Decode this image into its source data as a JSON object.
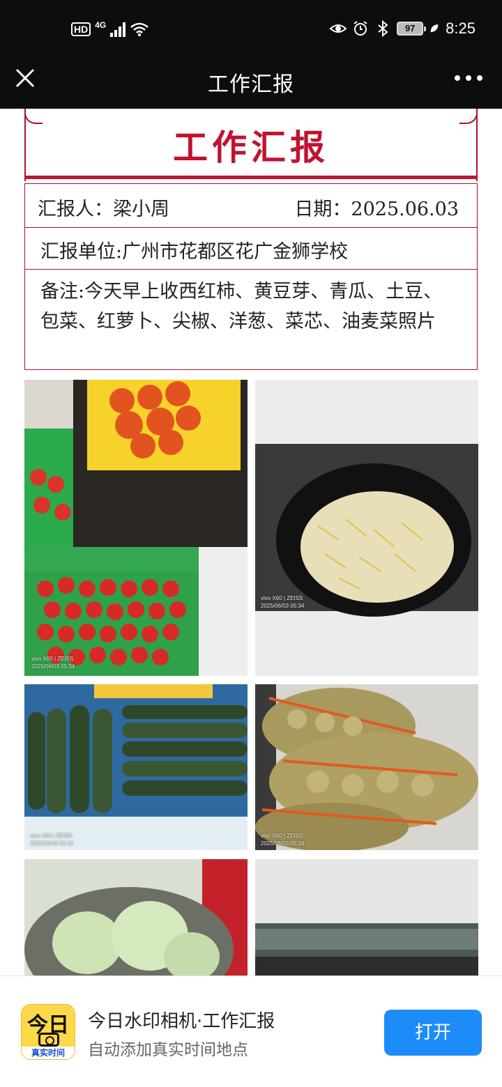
{
  "status_bar": {
    "hd_label": "HD",
    "network_label": "4G",
    "battery_level": "97",
    "time": "8:25",
    "icons": [
      "hd-icon",
      "signal-icon",
      "wifi-icon",
      "eye-icon",
      "alarm-icon",
      "bluetooth-icon",
      "battery-icon",
      "leaf-icon"
    ]
  },
  "nav": {
    "title": "工作汇报",
    "close_icon": "close-icon",
    "more_icon": "more-icon"
  },
  "report": {
    "title": "工作汇报",
    "reporter": "汇报人：梁小周",
    "date": "日期：2025.06.03",
    "unit": "汇报单位:广州市花都区花广金狮学校",
    "note": "备注:今天早上收西红柿、黄豆芽、青瓜、土豆、包菜、红萝卜、尖椒、洋葱、菜芯、油麦菜照片",
    "accent_color": "#c0132f"
  },
  "photos": [
    {
      "watermark_device": "vivo X60 | ZEISS",
      "watermark_time": "2025/06/03 05:34"
    },
    {
      "watermark_device": "vivo X60 | ZEISS",
      "watermark_time": "2025/06/03 05:34"
    },
    {
      "watermark_device": "vivo X60 | ZEISS",
      "watermark_time": "2025/06/03 05:34"
    },
    {
      "watermark_device": "vivo X60 | ZEISS",
      "watermark_time": "2025/06/03 05:34"
    }
  ],
  "banner": {
    "app_icon_top": "今日",
    "app_icon_bottom": "真实时间",
    "title": "今日水印相机·工作汇报",
    "subtitle": "自动添加真实时间地点",
    "open_label": "打开",
    "button_color": "#1d8cf8"
  }
}
